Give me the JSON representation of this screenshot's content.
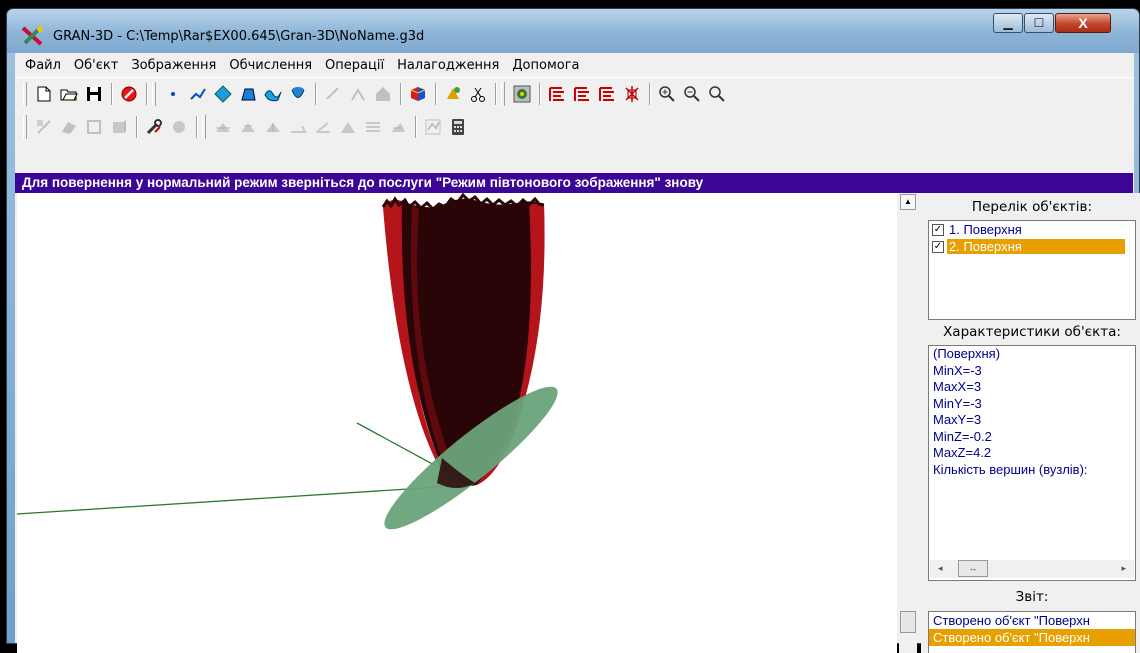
{
  "window": {
    "title": "GRAN-3D - C:\\Temp\\Rar$EX00.645\\Gran-3D\\NoName.g3d",
    "min_label": "▁",
    "max_label": "☐",
    "close_label": "X"
  },
  "menu": {
    "items": [
      "Файл",
      "Об'єкт",
      "Зображення",
      "Обчислення",
      "Операції",
      "Налагодження",
      "Допомога"
    ]
  },
  "infobar": {
    "text": "Для повернення у нормальний режим зверніться до послуги \"Режим півтонового зображення\" знову",
    "bg_color": "#3c0596"
  },
  "panel": {
    "objects_title": "Перелік об'єктів:",
    "objects": [
      {
        "label": "1. Поверхня",
        "checked": true,
        "selected": false
      },
      {
        "label": "2. Поверхня",
        "checked": true,
        "selected": true
      }
    ],
    "characteristics_title": "Характеристики об'єкта:",
    "characteristics": [
      " (Поверхня)",
      "MinX=-3",
      "MaxX=3",
      "MinY=-3",
      "MaxY=3",
      "MinZ=-0.2",
      "MaxZ=4.2",
      "Кількість вершин (вузлів):"
    ],
    "report_title": "Звіт:",
    "report": [
      {
        "text": "Створено об'єкт \"Поверхн",
        "selected": false
      },
      {
        "text": "Створено об'єкт \"Поверхн",
        "selected": true
      }
    ]
  },
  "colors": {
    "selection": "#e8a000",
    "surface_red": "#b5141b",
    "surface_dark": "#2a0508",
    "plane_green": "#6aa37a"
  }
}
